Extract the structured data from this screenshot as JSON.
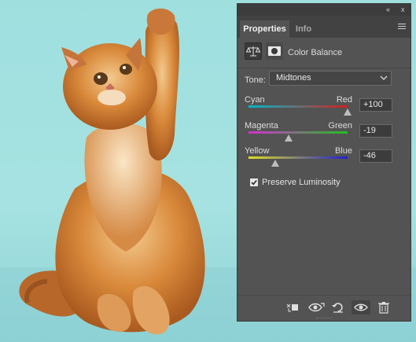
{
  "panel": {
    "tabs": [
      {
        "label": "Properties"
      },
      {
        "label": "Info"
      }
    ],
    "topbar": {
      "collapse_glyph": "«",
      "close_glyph": "x"
    },
    "adjustment_title": "Color Balance",
    "icons": [
      "balance-scale-icon",
      "layer-mask-icon",
      "panel-menu-icon",
      "chevron-down-icon"
    ],
    "tone": {
      "label": "Tone:",
      "value": "Midtones"
    },
    "sliders": [
      {
        "left": "Cyan",
        "right": "Red",
        "value_text": "+100",
        "value": 100,
        "min": -100,
        "max": 100,
        "gradient": [
          "#00b8c8",
          "#d02020"
        ]
      },
      {
        "left": "Magenta",
        "right": "Green",
        "value_text": "-19",
        "value": -19,
        "min": -100,
        "max": 100,
        "gradient": [
          "#d030d0",
          "#20c020"
        ]
      },
      {
        "left": "Yellow",
        "right": "Blue",
        "value_text": "-46",
        "value": -46,
        "min": -100,
        "max": 100,
        "gradient": [
          "#e0e020",
          "#2020d0"
        ]
      }
    ],
    "preserve_luminosity": {
      "label": "Preserve Luminosity",
      "checked": true
    },
    "footer_icons": [
      "clip-to-layer-icon",
      "view-previous-state-icon",
      "reset-icon",
      "visibility-eye-icon",
      "trash-icon"
    ]
  },
  "colors": {
    "panel_bg": "#535353",
    "canvas_bg": "#a6e2e1",
    "cat_fur": "#d9893a"
  }
}
